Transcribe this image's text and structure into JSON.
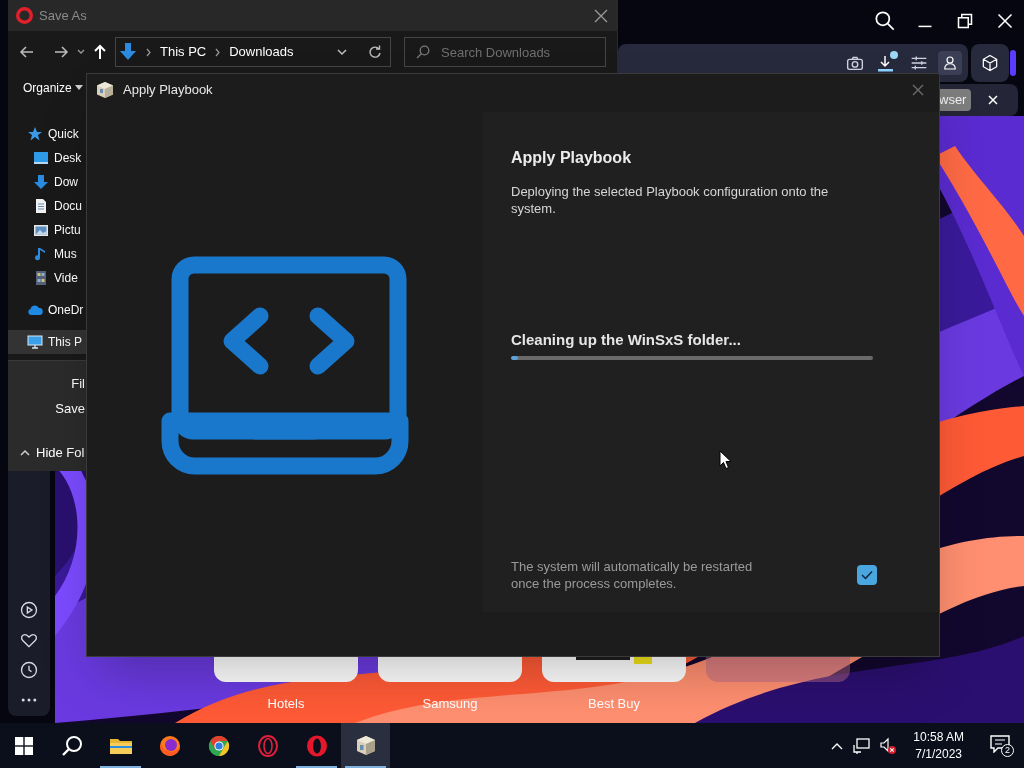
{
  "browser": {
    "tab_fragment": "wser",
    "speed_dial": [
      {
        "kind": "tile",
        "label": "Hotels"
      },
      {
        "kind": "tile",
        "label": "Samsung"
      },
      {
        "kind": "logo",
        "label": "Best Buy"
      },
      {
        "kind": "ghost"
      }
    ]
  },
  "save_as": {
    "title": "Save As",
    "breadcrumb": [
      "This PC",
      "Downloads"
    ],
    "search": {
      "placeholder": "Search Downloads"
    },
    "toolbar": [
      "Organize"
    ],
    "nav": [
      {
        "kind": "star",
        "label": "Quick",
        "selected": false
      },
      {
        "kind": "desktop",
        "label": "Desk",
        "selected": false
      },
      {
        "kind": "download",
        "label": "Dow",
        "selected": false
      },
      {
        "kind": "document",
        "label": "Docu",
        "selected": false
      },
      {
        "kind": "pictures",
        "label": "Pictu",
        "selected": false
      },
      {
        "kind": "music",
        "label": "Mus",
        "selected": false
      },
      {
        "kind": "video",
        "label": "Vide",
        "selected": false
      },
      {
        "kind": "cloud",
        "label": "OneDr",
        "selected": false
      },
      {
        "kind": "pc",
        "label": "This P",
        "selected": true
      }
    ],
    "fields": [
      "Fil",
      "Save"
    ],
    "hide_folders": "Hide Fol"
  },
  "dialog": {
    "title": "Apply Playbook",
    "heading": "Apply Playbook",
    "description": "Deploying the selected Playbook configuration onto the system.",
    "status": "Cleaning up the WinSxS folder...",
    "progress": {
      "level": 0.02
    },
    "restart": {
      "text": "The system will automatically be restarted once the process completes.",
      "checked": true
    }
  },
  "taskbar": {
    "apps": [
      {
        "kind": "explorer",
        "running": true,
        "selected": false
      },
      {
        "kind": "firefox",
        "running": false,
        "selected": false
      },
      {
        "kind": "chrome",
        "running": false,
        "selected": false
      },
      {
        "kind": "opera_gx",
        "running": false,
        "selected": false
      },
      {
        "kind": "opera",
        "running": true,
        "selected": false
      },
      {
        "kind": "playbook",
        "running": true,
        "selected": true
      }
    ],
    "time": "10:58 AM",
    "date": "7/1/2023",
    "notifications": "2"
  }
}
